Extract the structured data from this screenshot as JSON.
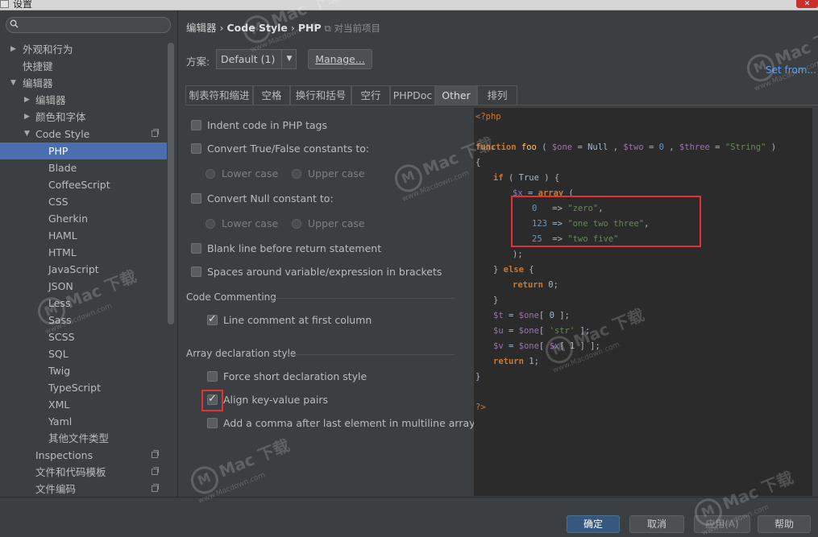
{
  "window": {
    "title": "设置",
    "close": "✕"
  },
  "sidebar": {
    "search_placeholder": "",
    "items": [
      {
        "label": "外观和行为",
        "arrow": "▶"
      },
      {
        "label": "快捷键"
      },
      {
        "label": "编辑器",
        "arrow": "▼"
      },
      {
        "label": "编辑器",
        "arrow": "▶"
      },
      {
        "label": "颜色和字体",
        "arrow": "▶"
      },
      {
        "label": "Code Style",
        "arrow": "▼"
      },
      {
        "label": "PHP"
      },
      {
        "label": "Blade"
      },
      {
        "label": "CoffeeScript"
      },
      {
        "label": "CSS"
      },
      {
        "label": "Gherkin"
      },
      {
        "label": "HAML"
      },
      {
        "label": "HTML"
      },
      {
        "label": "JavaScript"
      },
      {
        "label": "JSON"
      },
      {
        "label": "Less"
      },
      {
        "label": "Sass"
      },
      {
        "label": "SCSS"
      },
      {
        "label": "SQL"
      },
      {
        "label": "Twig"
      },
      {
        "label": "TypeScript"
      },
      {
        "label": "XML"
      },
      {
        "label": "Yaml"
      },
      {
        "label": "其他文件类型"
      },
      {
        "label": "Inspections"
      },
      {
        "label": "文件和代码模板"
      },
      {
        "label": "文件编码"
      }
    ]
  },
  "breadcrumb": {
    "part1": "编辑器",
    "sep": "›",
    "part2": "Code Style",
    "part3": "PHP",
    "note": "⧉ 对当前项目"
  },
  "scheme": {
    "label": "方案:",
    "value": "Default (1)",
    "arrow": "▼",
    "manage": "Manage...",
    "set_from": "Set from..."
  },
  "tabs": [
    "制表符和缩进",
    "空格",
    "换行和括号",
    "空行",
    "PHPDoc",
    "Other",
    "排列"
  ],
  "active_tab": "Other",
  "options": {
    "indent_php_tags": "Indent code in PHP tags",
    "convert_true_false": "Convert True/False constants to:",
    "lower_case": "Lower case",
    "upper_case": "Upper case",
    "convert_null": "Convert Null constant to:",
    "lower_case_2": "Lower case",
    "upper_case_2": "Upper case",
    "blank_line": "Blank line before return statement",
    "spaces_around": "Spaces around variable/expression in brackets",
    "code_commenting": "Code Commenting",
    "line_comment": "Line comment at first column",
    "array_decl": "Array declaration style",
    "force_short": "Force short declaration style",
    "align_kv": "Align key-value pairs",
    "add_comma": "Add a comma after last element in multiline array"
  },
  "code": {
    "open_tag": "<?php",
    "l_function_kw": "function",
    "l_function_name": " foo ",
    "l_function_rest_a": "( ",
    "v_one": "$one",
    "eq_null": " = Null , ",
    "v_two": "$two",
    "eq_zero": " = ",
    "n_zero": "0",
    "comma": " , ",
    "v_three": "$three",
    "eq": " = ",
    "s_string": "\"String\"",
    "close_paren": " )",
    "brace_open": "{",
    "if_kw": "if",
    "if_cond": " ( True ) {",
    "v_x": "$x",
    "eq_arr": " = ",
    "array_kw": "array",
    "arr_open": " (",
    "k0": "0",
    "arrow0": "   => ",
    "s_zero": "\"zero\"",
    "c0": ",",
    "k1": "123",
    "arrow1": " => ",
    "s_one": "\"one two three\"",
    "c1": ",",
    "k2": "25",
    "arrow2": "  => ",
    "s_two": "\"two five\"",
    "arr_close": ");",
    "else_open": "} ",
    "else_kw": "else",
    "else_brace": " {",
    "return_kw": "return",
    "ret0": " 0;",
    "brace_close": "}",
    "v_t": "$t",
    "t_rest_a": " = ",
    "v_one_b": "$one",
    "t_rest_b": "[ 0 ];",
    "v_u": "$u",
    "u_rest_a": " = ",
    "v_one_c": "$one",
    "u_rest_b": "[ ",
    "s_str": "'str'",
    "u_rest_c": " ];",
    "v_v": "$v",
    "v_rest_a": " = ",
    "v_one_d": "$one",
    "v_rest_b": "[ ",
    "v_x2": "$x",
    "v_rest_c": "[ 1 ] ];",
    "return_kw2": "return",
    "ret1": " 1;",
    "func_close": "}",
    "close_tag": "?>"
  },
  "buttons": {
    "ok": "确定",
    "cancel": "取消",
    "apply": "应用(A)",
    "help": "帮助"
  },
  "watermark": {
    "logo": "M",
    "brand": "Mac 下载",
    "site": "www.Macdown.com"
  }
}
